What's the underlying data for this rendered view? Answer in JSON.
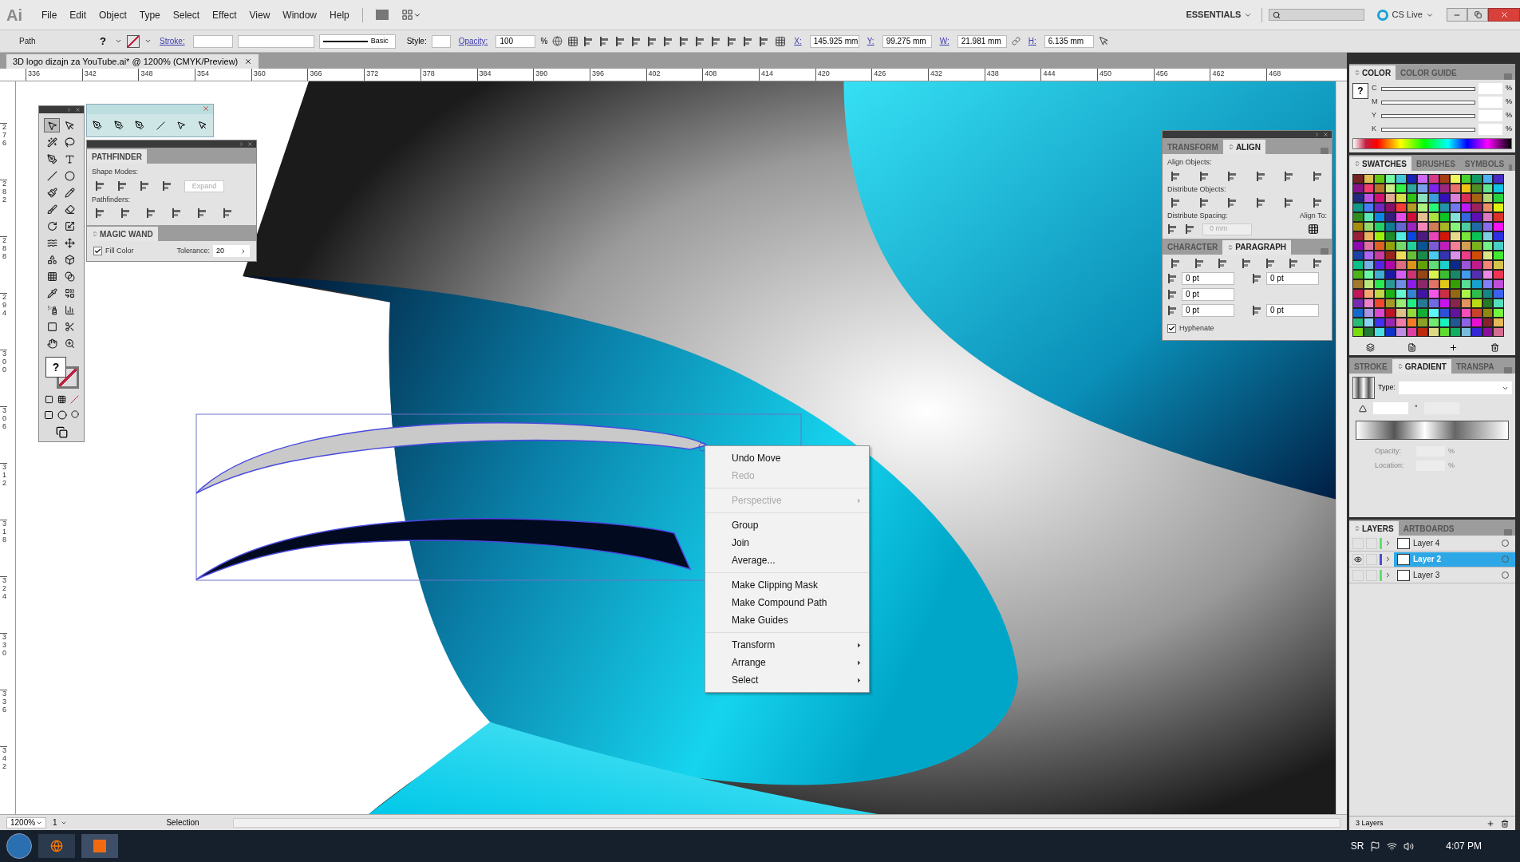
{
  "app": {
    "logo": "Ai",
    "menus": [
      "File",
      "Edit",
      "Object",
      "Type",
      "Select",
      "Effect",
      "View",
      "Window",
      "Help"
    ],
    "workspace": "ESSENTIALS",
    "cs_live": "CS Live"
  },
  "control_bar": {
    "selection_type": "Path",
    "fill": "?",
    "stroke_label": "Stroke:",
    "stroke_profile": "Basic",
    "style_label": "Style:",
    "opacity_label": "Opacity:",
    "opacity": "100",
    "opacity_unit": "%",
    "x_label": "X:",
    "x": "145.925 mm",
    "y_label": "Y:",
    "y": "99.275 mm",
    "w_label": "W:",
    "w": "21.981 mm",
    "h_label": "H:",
    "h": "6.135 mm"
  },
  "document_tab": {
    "title": "3D logo dizajn za YouTube.ai* @ 1200% (CMYK/Preview)"
  },
  "rulers": {
    "horizontal": [
      "336",
      "342",
      "348",
      "354",
      "360",
      "366",
      "372",
      "378",
      "384",
      "390",
      "396",
      "402",
      "408",
      "414",
      "420",
      "426",
      "432",
      "438",
      "444",
      "450",
      "456",
      "462",
      "468"
    ],
    "vertical": [
      "276",
      "282",
      "288",
      "294",
      "300",
      "306",
      "312",
      "318",
      "324",
      "330",
      "336",
      "342"
    ]
  },
  "toolbox": {
    "fill_swatch": "?",
    "tools": [
      {
        "kind": "selection",
        "selected": true
      },
      {
        "kind": "direct-selection",
        "selected": false
      },
      {
        "kind": "magic-wand",
        "selected": false
      },
      {
        "kind": "lasso",
        "selected": false
      },
      {
        "kind": "pen",
        "selected": false
      },
      {
        "kind": "type",
        "selected": false
      },
      {
        "kind": "line",
        "selected": false
      },
      {
        "kind": "ellipse",
        "selected": false
      },
      {
        "kind": "paintbrush",
        "selected": false
      },
      {
        "kind": "pencil",
        "selected": false
      },
      {
        "kind": "blob-brush",
        "selected": false
      },
      {
        "kind": "eraser",
        "selected": false
      },
      {
        "kind": "rotate",
        "selected": false
      },
      {
        "kind": "scale",
        "selected": false
      },
      {
        "kind": "warp",
        "selected": false
      },
      {
        "kind": "free-transform",
        "selected": false
      },
      {
        "kind": "shape-builder",
        "selected": false
      },
      {
        "kind": "perspective",
        "selected": false
      },
      {
        "kind": "mesh",
        "selected": false
      },
      {
        "kind": "gradient",
        "selected": false
      },
      {
        "kind": "eyedropper",
        "selected": false
      },
      {
        "kind": "blend",
        "selected": false
      },
      {
        "kind": "symbol-sprayer",
        "selected": false
      },
      {
        "kind": "graph",
        "selected": false
      },
      {
        "kind": "artboard",
        "selected": false
      },
      {
        "kind": "slice",
        "selected": false
      },
      {
        "kind": "hand",
        "selected": false
      },
      {
        "kind": "zoom",
        "selected": false
      }
    ]
  },
  "pathfinder_panel": {
    "title": "PATHFINDER",
    "shape_modes_label": "Shape Modes:",
    "expand_button": "Expand",
    "pathfinders_label": "Pathfinders:"
  },
  "magic_wand_panel": {
    "title": "MAGIC WAND",
    "fill_color": {
      "label": "Fill Color",
      "checked": true
    },
    "tolerance_label": "Tolerance:",
    "tolerance": "20"
  },
  "align_panel": {
    "tabs": [
      {
        "label": "TRANSFORM",
        "selected": false
      },
      {
        "label": "ALIGN",
        "selected": true
      }
    ],
    "align_objects_label": "Align Objects:",
    "distribute_objects_label": "Distribute Objects:",
    "distribute_spacing_label": "Distribute Spacing:",
    "spacing": "0 mm",
    "align_to_label": "Align To:"
  },
  "paragraph_panel": {
    "tabs": [
      {
        "label": "CHARACTER",
        "selected": false
      },
      {
        "label": "PARAGRAPH",
        "selected": true
      }
    ],
    "fields": [
      "0 pt",
      "0 pt",
      "0 pt",
      "0 pt",
      "0 pt"
    ],
    "hyphenate": {
      "label": "Hyphenate",
      "checked": true
    }
  },
  "context_menu": {
    "groups": [
      [
        {
          "label": "Undo Move",
          "disabled": false,
          "submenu": false
        },
        {
          "label": "Redo",
          "disabled": true,
          "submenu": false
        }
      ],
      [
        {
          "label": "Perspective",
          "disabled": true,
          "submenu": true
        }
      ],
      [
        {
          "label": "Group",
          "disabled": false,
          "submenu": false
        },
        {
          "label": "Join",
          "disabled": false,
          "submenu": false
        },
        {
          "label": "Average...",
          "disabled": false,
          "submenu": false
        }
      ],
      [
        {
          "label": "Make Clipping Mask",
          "disabled": false,
          "submenu": false
        },
        {
          "label": "Make Compound Path",
          "disabled": false,
          "submenu": false
        },
        {
          "label": "Make Guides",
          "disabled": false,
          "submenu": false
        }
      ],
      [
        {
          "label": "Transform",
          "disabled": false,
          "submenu": true
        },
        {
          "label": "Arrange",
          "disabled": false,
          "submenu": true
        },
        {
          "label": "Select",
          "disabled": false,
          "submenu": true
        }
      ]
    ]
  },
  "color_panel": {
    "tabs": [
      {
        "label": "COLOR",
        "selected": true
      },
      {
        "label": "COLOR GUIDE",
        "selected": false
      }
    ],
    "fill_swatch": "?",
    "channels": [
      {
        "label": "C",
        "unit": "%"
      },
      {
        "label": "M",
        "unit": "%"
      },
      {
        "label": "Y",
        "unit": "%"
      },
      {
        "label": "K",
        "unit": "%"
      }
    ]
  },
  "swatches_panel": {
    "tabs": [
      {
        "label": "SWATCHES",
        "selected": true
      },
      {
        "label": "BRUSHES",
        "selected": false
      },
      {
        "label": "SYMBOLS",
        "selected": false
      }
    ]
  },
  "gradient_panel": {
    "tabs": [
      {
        "label": "STROKE",
        "selected": false
      },
      {
        "label": "GRADIENT",
        "selected": true
      },
      {
        "label": "TRANSPA",
        "selected": false
      }
    ],
    "type_label": "Type:",
    "angle_unit": "°",
    "opacity_label": "Opacity:",
    "location_label": "Location:",
    "unit": "%"
  },
  "layers_panel": {
    "tabs": [
      {
        "label": "LAYERS",
        "selected": true
      },
      {
        "label": "ARTBOARDS",
        "selected": false
      }
    ],
    "layers": [
      {
        "name": "Layer 4",
        "selected": false,
        "visible": false,
        "color": "#5fe06a"
      },
      {
        "name": "Layer 2",
        "selected": true,
        "visible": true,
        "color": "#4b4bd8"
      },
      {
        "name": "Layer 3",
        "selected": false,
        "visible": false,
        "color": "#5fe06a"
      }
    ],
    "count": "3 Layers"
  },
  "status_bar": {
    "zoom": "1200%",
    "artboard": "1",
    "tool": "Selection"
  },
  "taskbar": {
    "language": "SR",
    "time": "4:07 PM"
  }
}
